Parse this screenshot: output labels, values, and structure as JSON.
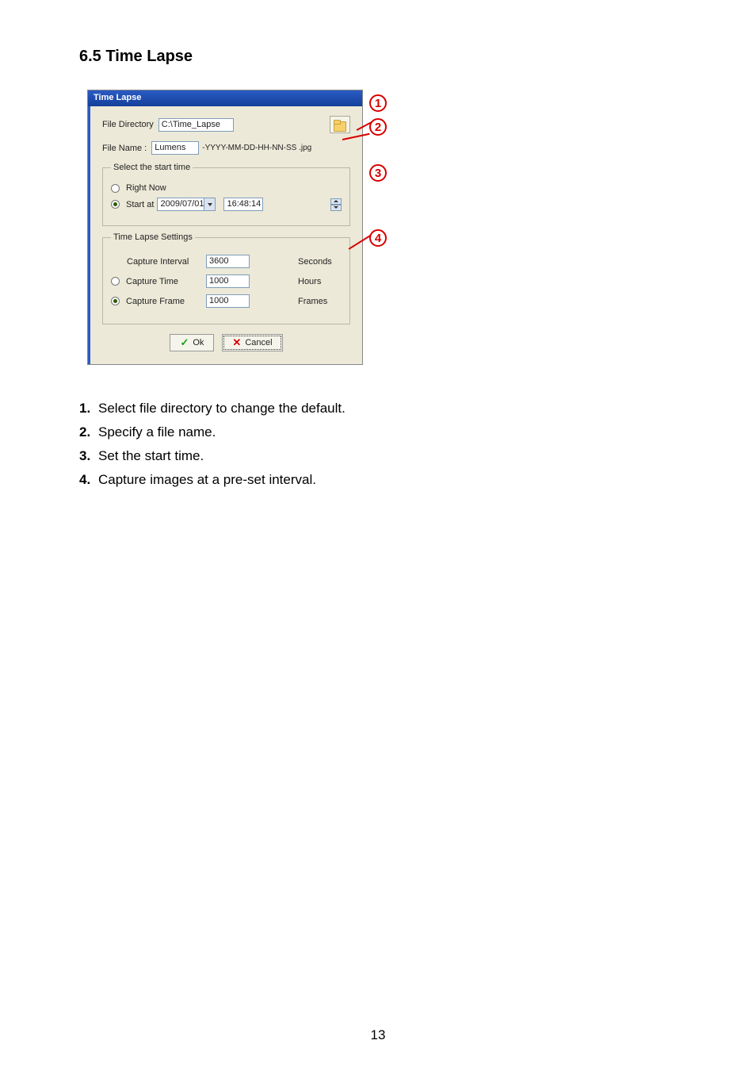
{
  "heading": "6.5 Time Lapse",
  "dialog": {
    "title": "Time Lapse",
    "fileDirectoryLabel": "File Directory",
    "fileDirectoryValue": "C:\\Time_Lapse",
    "fileNameLabel": "File Name :",
    "fileNameValue": "Lumens",
    "fileNameSuffix": "-YYYY-MM-DD-HH-NN-SS .jpg",
    "startGroup": {
      "legend": "Select the start time",
      "rightNow": "Right Now",
      "startAt": "Start at",
      "date": "2009/07/01",
      "time": "16:48:14"
    },
    "settingsGroup": {
      "legend": "Time Lapse Settings",
      "captureIntervalLabel": "Capture Interval",
      "captureIntervalValue": "3600",
      "captureIntervalUnit": "Seconds",
      "captureTimeLabel": "Capture Time",
      "captureTimeValue": "1000",
      "captureTimeUnit": "Hours",
      "captureFrameLabel": "Capture Frame",
      "captureFrameValue": "1000",
      "captureFrameUnit": "Frames"
    },
    "okLabel": "Ok",
    "cancelLabel": "Cancel"
  },
  "callouts": [
    "1",
    "2",
    "3",
    "4"
  ],
  "instructions": [
    "Select file directory to change the default.",
    "Specify a file name.",
    "Set the start time.",
    "Capture images at a pre-set interval."
  ],
  "pageNumber": "13"
}
